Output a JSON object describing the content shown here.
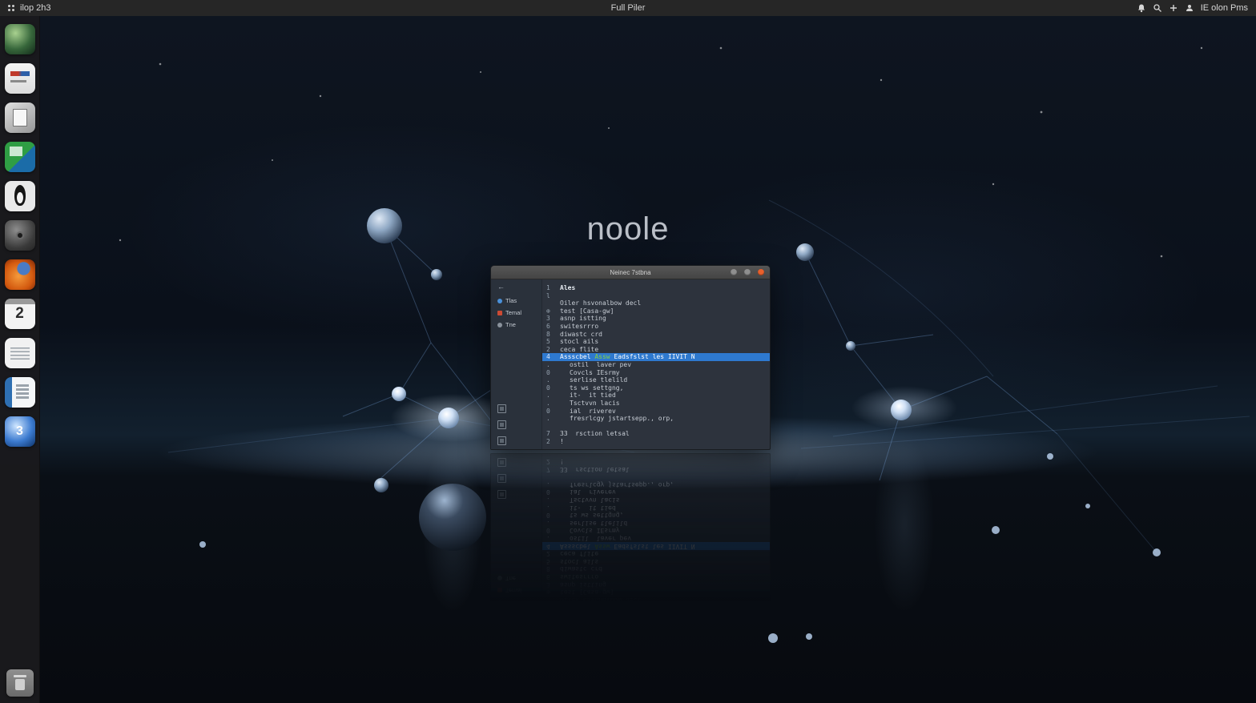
{
  "topbar": {
    "left": "ilop 2h3",
    "center": "Full Piler",
    "right": "IE olon Pms"
  },
  "desktop": {
    "logo": "noole"
  },
  "dock": {
    "calendar_day": "2",
    "clock_label": "3"
  },
  "window": {
    "title": "Neinec 7stbna",
    "back": "←",
    "sidebar": [
      {
        "label": "Tlas"
      },
      {
        "label": "Temal"
      },
      {
        "label": "Tne"
      }
    ],
    "rows": [
      {
        "n": "1",
        "t": "Ales"
      },
      {
        "n": "l",
        "t": ""
      },
      {
        "n": "",
        "t": "Oiler hsvonalbow decl"
      },
      {
        "n": "⊕",
        "t": "test [Casa-gw]"
      },
      {
        "n": "3",
        "t": "asnp istting"
      },
      {
        "n": "6",
        "t": "switesrrro"
      },
      {
        "n": "8",
        "t": "diwastc crd"
      },
      {
        "n": "5",
        "t": "stocl ails"
      },
      {
        "n": "2",
        "t": "ceca flite"
      },
      {
        "n": "4",
        "seg_a": "Assscbel ",
        "seg_b": "Assw ",
        "seg_c": "Eadsfslst les IIVIT N"
      },
      {
        "n": ".",
        "t": "ostil  laver pev"
      },
      {
        "n": "0",
        "t": "Covcls IEsrmy"
      },
      {
        "n": ".",
        "t": "serlise tlelild"
      },
      {
        "n": "0",
        "t": "ts ws settgng,"
      },
      {
        "n": ".",
        "t": "it-  it tied"
      },
      {
        "n": ".",
        "t": "Tsctvvn lacis"
      },
      {
        "n": "0",
        "t": "ial  riverev"
      },
      {
        "n": ".",
        "t": "fresrlcgy jstartsepp., orp,"
      },
      {
        "n": "",
        "t": ""
      },
      {
        "n": "7",
        "t": "33  rsction letsal"
      },
      {
        "n": "2",
        "t": "!"
      }
    ]
  }
}
